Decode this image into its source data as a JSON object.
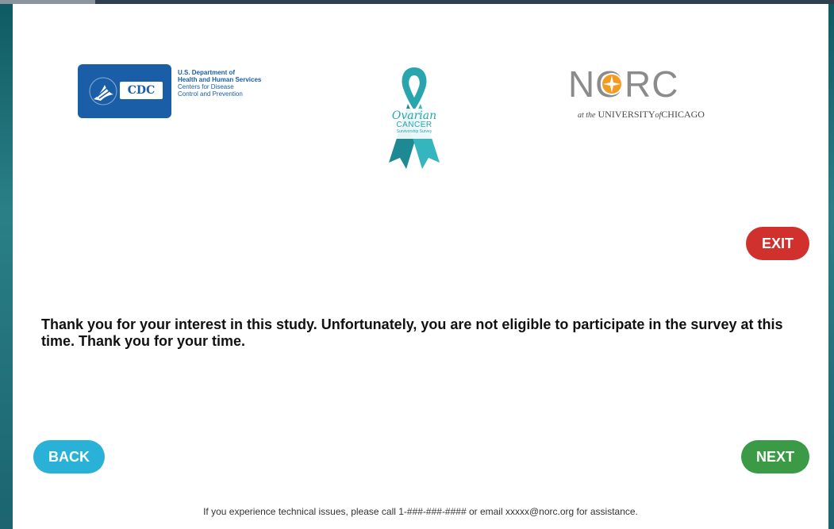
{
  "cdc": {
    "badge": "CDC",
    "line1": "U.S. Department of",
    "line2": "Health and Human Services",
    "line3": "Centers for Disease",
    "line4": "Control and Prevention"
  },
  "ribbon": {
    "line1": "Ovarian",
    "line2": "CANCER",
    "line3": "Survivorship Survey",
    "color": "#2aa4ad"
  },
  "norc": {
    "wordmark": "NORC",
    "prefix": "at the",
    "university": "UNIVERSITY",
    "of": "of",
    "city": "CHICAGO",
    "accent": "#f39a1f"
  },
  "buttons": {
    "exit": "EXIT",
    "back": "BACK",
    "next": "NEXT"
  },
  "message": "Thank you for your interest in this study. Unfortunately, you are not eligible to participate in the survey at this time. Thank you for your time.",
  "footer": "If you experience technical issues, please call 1-###-###-#### or email xxxxx@norc.org for assistance.",
  "colors": {
    "exit": "#d0312d",
    "back": "#29b1d7",
    "next": "#3a9a46",
    "cdc_blue": "#1a5ea8"
  }
}
